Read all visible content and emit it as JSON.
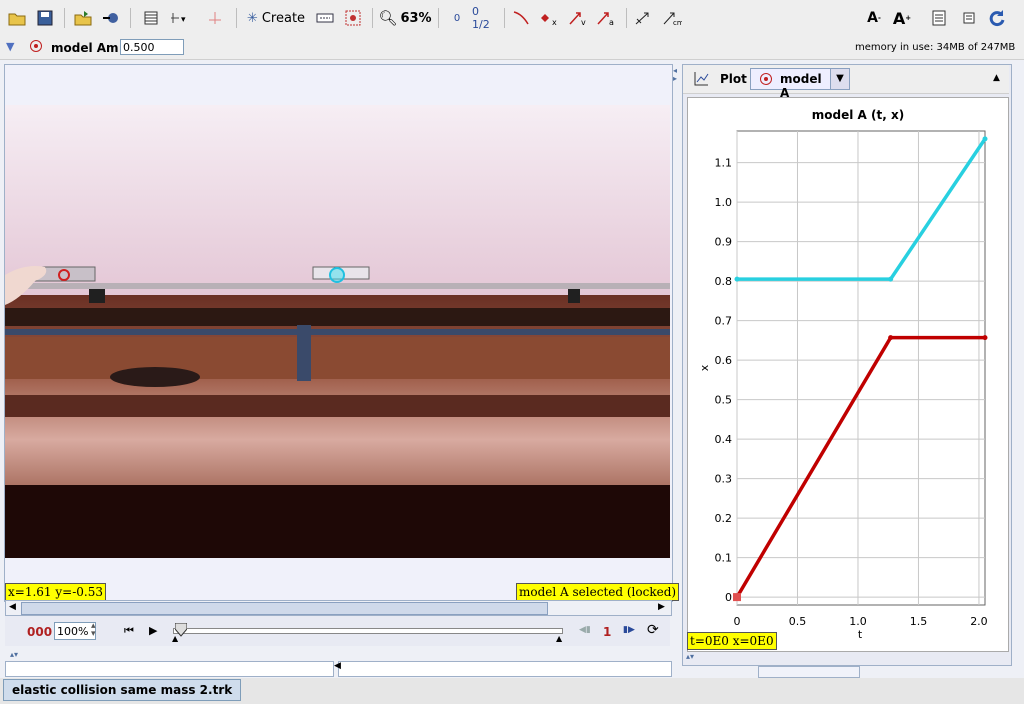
{
  "toolbar": {
    "create_label": "Create",
    "zoom_label": "63%",
    "ordinal_label": "0",
    "step_label": "0 1/2"
  },
  "selection": {
    "track_name": "model A",
    "mass_label": "m",
    "mass_value": "0.500",
    "memory_text": "memory in use: 34MB of 247MB"
  },
  "video": {
    "coords_readout": "x=1.61  y=-0.53",
    "selection_status": "model A selected (locked)"
  },
  "player": {
    "frame_counter": "000",
    "rate_value": "100%",
    "step_size": "1",
    "slider_position": 0
  },
  "plot": {
    "tab_label": "Plot",
    "track_selector": "model A",
    "readout": "t=0E0  x=0E0"
  },
  "chart_data": {
    "type": "line",
    "title": "model A (t, x)",
    "xlabel": "t",
    "ylabel": "x",
    "xlim": [
      0,
      2.05
    ],
    "ylim": [
      -0.02,
      1.18
    ],
    "xticks": [
      0,
      0.5,
      1.0,
      1.5,
      2.0
    ],
    "xtick_labels": [
      "0",
      "0.5",
      "1.0",
      "1.5",
      "2.0"
    ],
    "yticks": [
      0,
      0.1,
      0.2,
      0.3,
      0.4,
      0.5,
      0.6,
      0.7,
      0.8,
      0.9,
      1.0,
      1.1
    ],
    "ytick_labels": [
      "0",
      "0.1",
      "0.2",
      "0.3",
      "0.4",
      "0.5",
      "0.6",
      "0.7",
      "0.8",
      "0.9",
      "1.0",
      "1.1"
    ],
    "grid": true,
    "series": [
      {
        "color": "#c00000",
        "x": [
          0,
          1.27,
          2.05
        ],
        "y": [
          0,
          0.657,
          0.657
        ]
      },
      {
        "color": "#28d0e0",
        "x": [
          0,
          1.27,
          2.05
        ],
        "y": [
          0.805,
          0.805,
          1.16
        ]
      }
    ]
  },
  "file_tab": {
    "label": "elastic collision same mass 2.trk"
  }
}
